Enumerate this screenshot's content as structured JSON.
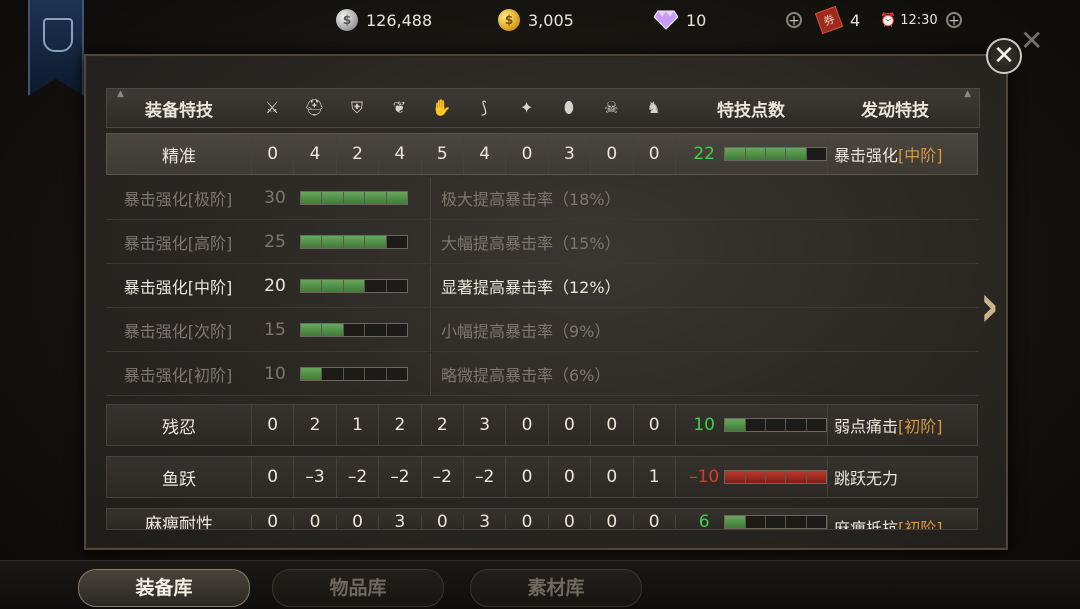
{
  "topbar": {
    "silver": "126,488",
    "gold": "3,005",
    "gems": "10",
    "tickets": "4",
    "time": "12:30"
  },
  "header": {
    "col_name": "装备特技",
    "col_points": "特技点数",
    "col_active": "发动特技",
    "slot_icons": [
      "sword-icon",
      "helmet-icon",
      "chest-armor-icon",
      "shoulder-icon",
      "gauntlet-icon",
      "boots-icon",
      "charm-icon",
      "pendant-icon",
      "mask-icon",
      "horse-icon"
    ]
  },
  "rows": [
    {
      "name": "精准",
      "vals": [
        "0",
        "4",
        "2",
        "4",
        "5",
        "4",
        "0",
        "3",
        "0",
        "0"
      ],
      "points": "22",
      "filled": 4,
      "skill": "暴击强化",
      "tier": "[中阶]"
    },
    {
      "name": "残忍",
      "vals": [
        "0",
        "2",
        "1",
        "2",
        "2",
        "3",
        "0",
        "0",
        "0",
        "0"
      ],
      "points": "10",
      "filled": 1,
      "skill": "弱点痛击",
      "tier": "[初阶]"
    },
    {
      "name": "鱼跃",
      "vals": [
        "0",
        "–3",
        "–2",
        "–2",
        "–2",
        "–2",
        "0",
        "0",
        "0",
        "1"
      ],
      "points": "–10",
      "filled": 0,
      "skill": "跳跃无力",
      "tier": ""
    },
    {
      "name": "麻痹耐性",
      "vals": [
        "0",
        "0",
        "0",
        "3",
        "0",
        "3",
        "0",
        "0",
        "0",
        "0"
      ],
      "points": "6",
      "filled": 1,
      "skill": "麻痹抵抗",
      "tier": "[初阶]"
    }
  ],
  "details": [
    {
      "name": "暴击强化[极阶]",
      "threshold": "30",
      "filled": 5,
      "desc": "极大提高暴击率（18%）",
      "active": false
    },
    {
      "name": "暴击强化[高阶]",
      "threshold": "25",
      "filled": 4,
      "desc": "大幅提高暴击率（15%）",
      "active": false
    },
    {
      "name": "暴击强化[中阶]",
      "threshold": "20",
      "filled": 3,
      "desc": "显著提高暴击率（12%）",
      "active": true
    },
    {
      "name": "暴击强化[次阶]",
      "threshold": "15",
      "filled": 2,
      "desc": "小幅提高暴击率（9%）",
      "active": false
    },
    {
      "name": "暴击强化[初阶]",
      "threshold": "10",
      "filled": 1,
      "desc": "略微提高暴击率（6%）",
      "active": false
    }
  ],
  "tabs": [
    "装备库",
    "物品库",
    "素材库"
  ]
}
